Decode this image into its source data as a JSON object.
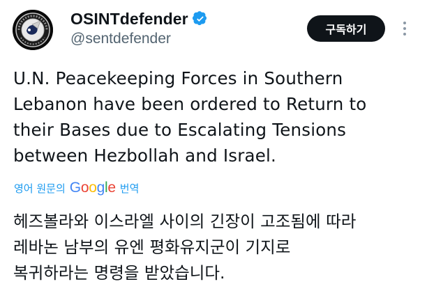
{
  "author": {
    "display_name": "OSINTdefender",
    "handle": "@sentdefender",
    "verified": true,
    "avatar_icon": "osint-defender-seal"
  },
  "actions": {
    "subscribe_label": "구독하기",
    "more_icon": "more-vertical-icon"
  },
  "tweet": {
    "text": "U.N. Peacekeeping Forces in Southern\nLebanon have been ordered to Return to\ntheir Bases due to Escalating Tensions\nbetween Hezbollah and Israel."
  },
  "translation": {
    "prefix": "영어 원문의",
    "provider_letters": [
      "G",
      "o",
      "o",
      "g",
      "l",
      "e"
    ],
    "suffix": "번역",
    "text": "헤즈볼라와 이스라엘 사이의 긴장이 고조됨에 따라\n레바논 남부의 유엔 평화유지군이 기지로\n복귀하라는 명령을 받았습니다."
  },
  "colors": {
    "text": "#0f1419",
    "secondary": "#536471",
    "link": "#1d9bf0",
    "verified_badge": "#1d9bf0",
    "button_bg": "#0f1419"
  }
}
